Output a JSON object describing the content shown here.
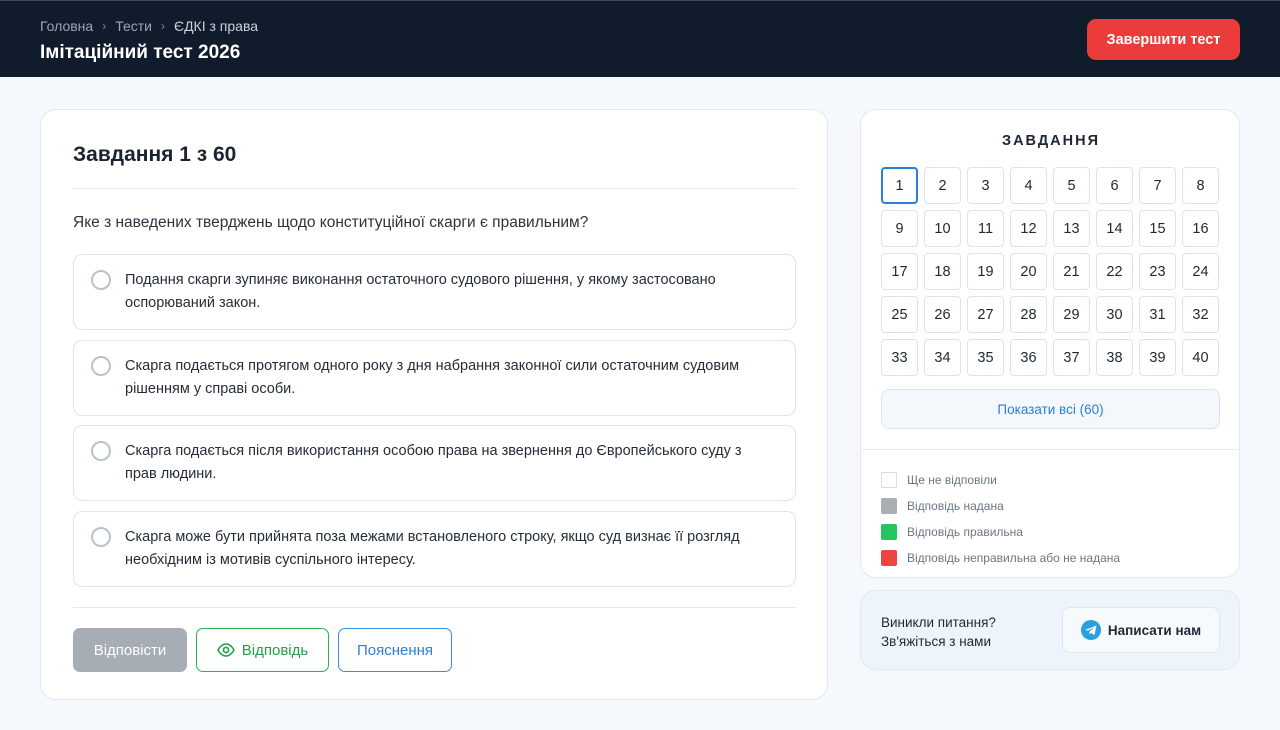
{
  "header": {
    "breadcrumb": [
      "Головна",
      "Тести",
      "ЄДКІ з права"
    ],
    "title": "Імітаційний тест 2026",
    "finish_label": "Завершити тест",
    "finish_color": "#ec3b3b"
  },
  "question": {
    "heading": "Завдання 1 з 60",
    "text": "Яке з наведених тверджень щодо конституційної скарги є правильним?",
    "options": [
      "Подання скарги зупиняє виконання остаточного судового рішення, у якому застосовано оспорюваний закон.",
      "Скарга подається протягом одного року з дня набрання законної сили остаточним судовим рішенням у справі особи.",
      "Скарга подається після використання особою права на звернення до Європейського суду з прав людини.",
      "Скарга може бути прийнята поза межами встановленого строку, якщо суд визнає її розгляд необхідним із мотивів суспільного інтересу."
    ],
    "buttons": {
      "submit": "Відповісти",
      "answer": "Відповідь",
      "explain": "Пояснення"
    }
  },
  "navigator": {
    "title": "ЗАВДАННЯ",
    "current": "1",
    "cells": [
      "1",
      "2",
      "3",
      "4",
      "5",
      "6",
      "7",
      "8",
      "9",
      "10",
      "11",
      "12",
      "13",
      "14",
      "15",
      "16",
      "17",
      "18",
      "19",
      "20",
      "21",
      "22",
      "23",
      "24",
      "25",
      "26",
      "27",
      "28",
      "29",
      "30",
      "31",
      "32",
      "33",
      "34",
      "35",
      "36",
      "37",
      "38",
      "39",
      "40"
    ],
    "show_all": "Показати всі (60)",
    "legend": [
      {
        "label": "Ще не відповіли",
        "color": "#ffffff"
      },
      {
        "label": "Відповідь надана",
        "color": "#a9aeb4"
      },
      {
        "label": "Відповідь правильна",
        "color": "#22c55e"
      },
      {
        "label": "Відповідь неправильна або не надана",
        "color": "#ef4444"
      }
    ]
  },
  "contact": {
    "line1": "Виникли питання?",
    "line2": "Зв'яжіться з нами",
    "button": "Написати нам",
    "icon": "telegram-icon"
  }
}
